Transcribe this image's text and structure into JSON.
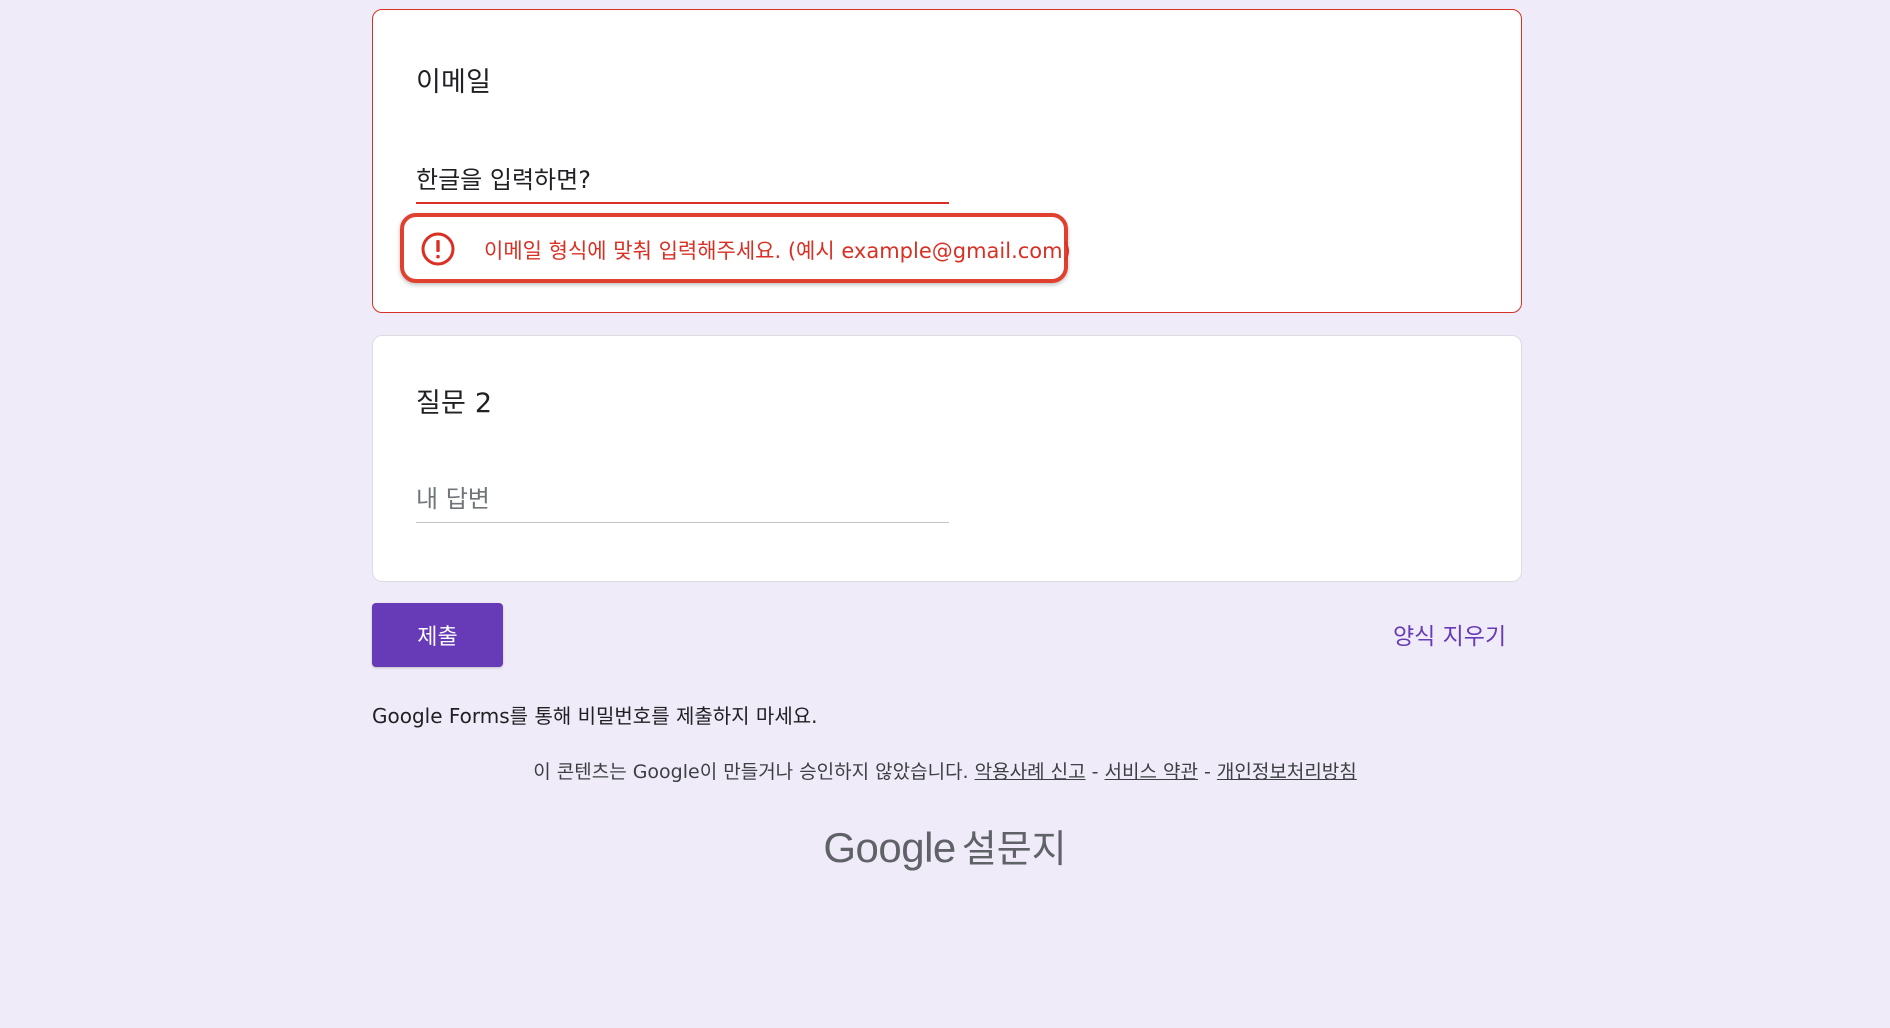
{
  "questions": [
    {
      "title": "이메일",
      "value": "한글을 입력하면?",
      "error": "이메일 형식에 맞춰 입력해주세요. (예시 example@gmail.com)"
    },
    {
      "title": "질문 2",
      "placeholder": "내 답변"
    }
  ],
  "actions": {
    "submit_label": "제출",
    "clear_label": "양식 지우기"
  },
  "footer": {
    "password_warning": "Google Forms를 통해 비밀번호를 제출하지 마세요.",
    "disclaimer_text": "이 콘텐츠는 Google이 만들거나 승인하지 않았습니다.",
    "separator": "-",
    "links": [
      "악용사례 신고",
      "서비스 약관",
      "개인정보처리방침"
    ],
    "brand_google": "Google",
    "brand_product": "설문지"
  },
  "colors": {
    "background": "#f0ebf8",
    "accent": "#673ab7",
    "error": "#d93025",
    "highlight_outline": "#e0412f"
  },
  "icons": {
    "error": "error-exclamation-circle-icon"
  }
}
